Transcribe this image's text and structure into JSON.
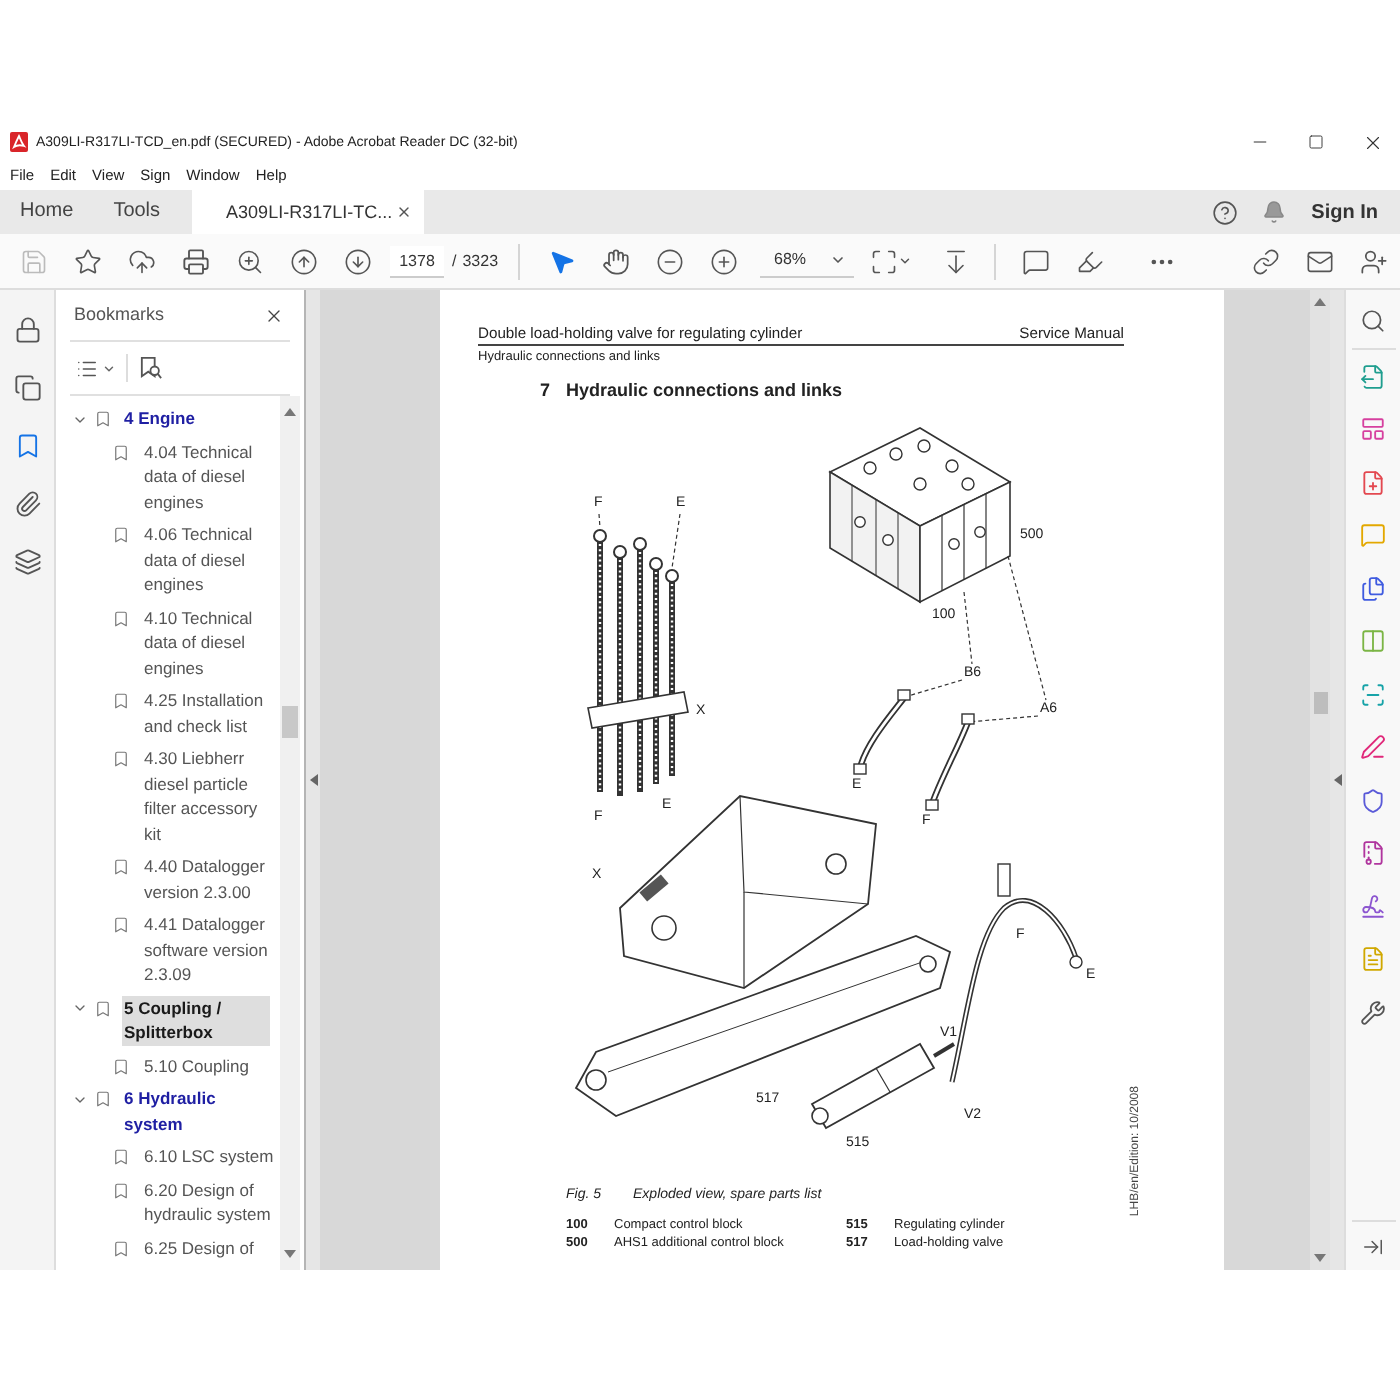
{
  "window": {
    "title": "A309LI-R317LI-TCD_en.pdf (SECURED) - Adobe Acrobat Reader DC (32-bit)"
  },
  "menu": [
    "File",
    "Edit",
    "View",
    "Sign",
    "Window",
    "Help"
  ],
  "tabs": [
    {
      "label": "Home",
      "selected": false,
      "closable": false
    },
    {
      "label": "Tools",
      "selected": false,
      "closable": false
    },
    {
      "label": "A309LI-R317LI-TC...",
      "selected": true,
      "closable": true
    }
  ],
  "account": {
    "sign_in": "Sign In"
  },
  "toolbar": {
    "save": {
      "disabled": true
    },
    "page": {
      "current": "1378",
      "separator": "/",
      "total": "3323"
    },
    "tools": [
      {
        "kind": "select",
        "selected": true
      },
      {
        "kind": "hand",
        "selected": false
      }
    ],
    "zoom": "68%"
  },
  "side_rail": [
    {
      "kind": "lock",
      "selected": false
    },
    {
      "kind": "pages",
      "selected": false
    },
    {
      "kind": "bookmarks",
      "selected": true
    },
    {
      "kind": "attachments",
      "selected": false
    },
    {
      "kind": "layers",
      "selected": false
    }
  ],
  "bookmarks": {
    "title": "Bookmarks",
    "items": [
      {
        "label": "4 Engine",
        "expanded": true,
        "selected": false,
        "color": "#1f1fa3",
        "children": [
          {
            "label": "4.04 Technical data of diesel engines",
            "selected": false
          },
          {
            "label": "4.06 Technical data of diesel engines",
            "selected": false
          },
          {
            "label": "4.10 Technical data of diesel engines",
            "selected": false
          },
          {
            "label": "4.25 Installation and check list",
            "selected": false
          },
          {
            "label": "4.30 Liebherr diesel particle filter accessory kit",
            "selected": false
          },
          {
            "label": "4.40 Datalogger version 2.3.00",
            "selected": false
          },
          {
            "label": "4.41 Datalogger software version 2.3.09",
            "selected": false
          }
        ]
      },
      {
        "label": "5 Coupling / Splitterbox",
        "expanded": true,
        "selected": true,
        "color": "#1a1a1a",
        "children": [
          {
            "label": "5.10 Coupling",
            "selected": false
          }
        ]
      },
      {
        "label": "6 Hydraulic system",
        "expanded": true,
        "selected": false,
        "color": "#1f1fa3",
        "children": [
          {
            "label": "6.10 LSC system",
            "selected": false
          },
          {
            "label": "6.20 Design of hydraulic system",
            "selected": false
          },
          {
            "label": "6.25 Design of",
            "selected": false
          }
        ]
      }
    ]
  },
  "document": {
    "header_left": "Double load-holding valve for regulating cylinder",
    "header_right": "Service Manual",
    "subheader": "Hydraulic connections and links",
    "heading_number": "7",
    "heading": "Hydraulic connections and links",
    "callouts": [
      {
        "label": "F"
      },
      {
        "label": "E"
      },
      {
        "label": "500"
      },
      {
        "label": "100"
      },
      {
        "label": "B6"
      },
      {
        "label": "A6"
      },
      {
        "label": "X"
      },
      {
        "label": "E"
      },
      {
        "label": "F"
      },
      {
        "label": "E"
      },
      {
        "label": "F"
      },
      {
        "label": "X"
      },
      {
        "label": "F"
      },
      {
        "label": "E"
      },
      {
        "label": "V1"
      },
      {
        "label": "517"
      },
      {
        "label": "V2"
      },
      {
        "label": "515"
      }
    ],
    "caption_label": "Fig. 5",
    "caption": "Exploded view, spare parts list",
    "parts": [
      {
        "number": "100",
        "name": "Compact control block"
      },
      {
        "number": "515",
        "name": "Regulating cylinder"
      },
      {
        "number": "500",
        "name": "AHS1 additional control block"
      },
      {
        "number": "517",
        "name": "Load-holding valve"
      }
    ],
    "margin_note": "LHB/en/Edition: 10/2008"
  }
}
